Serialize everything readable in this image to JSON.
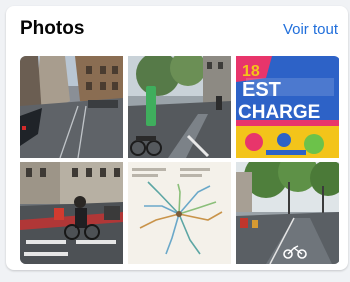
{
  "section": {
    "title": "Photos",
    "see_all_label": "Voir tout"
  },
  "photos": [
    {
      "alt": "Rue avec tramway"
    },
    {
      "alt": "Rue cyclable avec vélos"
    },
    {
      "alt": "Affiche festival"
    },
    {
      "alt": "Cycliste au carrefour"
    },
    {
      "alt": "Carte du réseau"
    },
    {
      "alt": "Piste cyclable arborée"
    }
  ],
  "poster": {
    "number": "18",
    "line1": "EST",
    "line2": "CHARGE"
  }
}
